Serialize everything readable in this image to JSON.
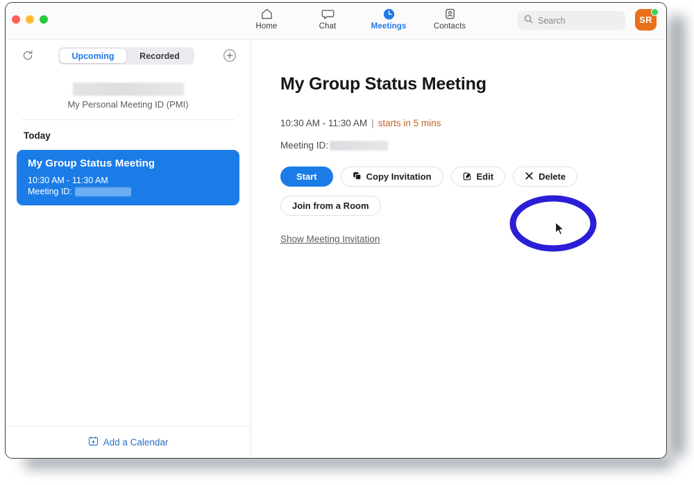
{
  "window": {
    "traffic_lights": [
      "close",
      "minimize",
      "zoom"
    ],
    "colors": {
      "accent_blue": "#1b7ce8",
      "tab_active_blue": "#2179e8",
      "avatar_orange": "#e8701a",
      "presence_green": "#3ad45c",
      "starts_in_orange": "#c0622b",
      "annotation_indigo": "#2a1fd6"
    }
  },
  "titlebar": {
    "tabs": [
      {
        "label": "Home",
        "icon": "home-icon",
        "active": false
      },
      {
        "label": "Chat",
        "icon": "chat-bubble-icon",
        "active": false
      },
      {
        "label": "Meetings",
        "icon": "clock-icon",
        "active": true
      },
      {
        "label": "Contacts",
        "icon": "contact-card-icon",
        "active": false
      }
    ],
    "search": {
      "placeholder": "Search",
      "value": "",
      "icon": "search-icon"
    },
    "avatar": {
      "initials": "SR",
      "status": "available"
    }
  },
  "sidebar": {
    "refresh_icon": "refresh-icon",
    "add_icon": "plus-circle-icon",
    "segments": [
      {
        "label": "Upcoming",
        "active": true
      },
      {
        "label": "Recorded",
        "active": false
      }
    ],
    "pmi": {
      "label": "My Personal Meeting ID (PMI)",
      "value_redacted": true
    },
    "section_header": "Today",
    "meeting_card": {
      "title": "My Group Status Meeting",
      "time": "10:30 AM - 11:30 AM",
      "id_label": "Meeting ID:",
      "id_redacted": true,
      "selected": true
    },
    "footer": {
      "label": "Add a Calendar",
      "icon": "calendar-plus-icon"
    }
  },
  "detail": {
    "title": "My Group Status Meeting",
    "time": "10:30 AM - 11:30 AM",
    "separator": "|",
    "starts_in": "starts in 5 mins",
    "id_label": "Meeting ID:",
    "id_redacted": true,
    "buttons": [
      {
        "label": "Start",
        "style": "primary",
        "icon": null
      },
      {
        "label": "Copy Invitation",
        "style": "secondary",
        "icon": "copy-icon"
      },
      {
        "label": "Edit",
        "style": "secondary",
        "icon": "pencil-square-icon"
      },
      {
        "label": "Delete",
        "style": "secondary",
        "icon": "close-x-icon"
      },
      {
        "label": "Join from a Room",
        "style": "secondary",
        "icon": null
      }
    ],
    "link": "Show Meeting Invitation"
  },
  "annotation": {
    "shape": "ellipse",
    "target": "Start",
    "color": "#2a1fd6",
    "cursor_visible": true
  }
}
